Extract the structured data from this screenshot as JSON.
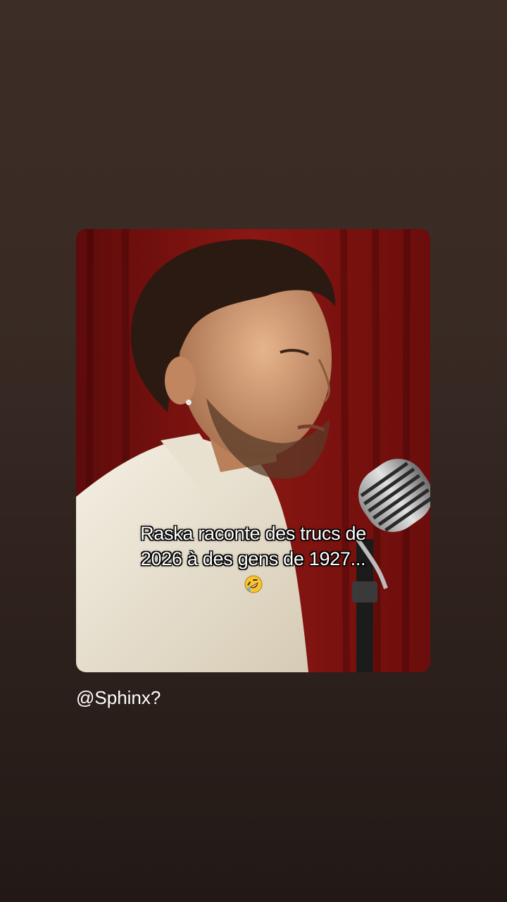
{
  "story": {
    "caption_line_1": "Raska raconte des trucs de",
    "caption_line_2": "2026 à des gens de 1927...",
    "caption_emoji": "rolling-on-floor-laughing-icon",
    "mention": "@Sphinx?"
  },
  "colors": {
    "background_top": "#3d2d27",
    "background_bottom": "#221916",
    "curtain": "#7a1010",
    "shirt": "#efe9dc",
    "caption_text": "#ffffff"
  }
}
